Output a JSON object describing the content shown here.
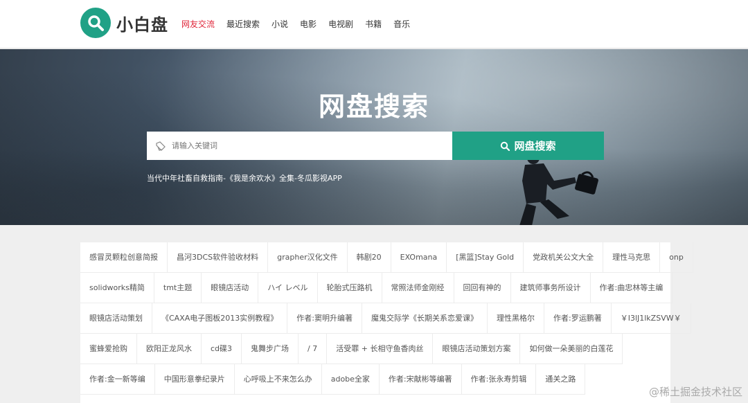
{
  "header": {
    "logo_text": "小白盘",
    "nav": [
      {
        "label": "网友交流",
        "active": true
      },
      {
        "label": "最近搜索",
        "active": false
      },
      {
        "label": "小说",
        "active": false
      },
      {
        "label": "电影",
        "active": false
      },
      {
        "label": "电视剧",
        "active": false
      },
      {
        "label": "书籍",
        "active": false
      },
      {
        "label": "音乐",
        "active": false
      }
    ]
  },
  "hero": {
    "title": "网盘搜索",
    "search_placeholder": "请输入关键词",
    "search_button": "网盘搜索",
    "promo_link": "当代中年社畜自救指南-《我是余欢水》全集-冬瓜影视APP"
  },
  "tags": [
    [
      "感冒灵颗粒创意简报",
      "昌河3DCS软件验收材料",
      "grapher汉化文件",
      "韩剧20",
      "EXOmana",
      "[黑篮]Stay Gold",
      "党政机关公文大全",
      "理性马克思",
      "onp"
    ],
    [
      "solidworks精简",
      "tmt主题",
      "眼镜店活动",
      "ハイ レベル",
      "轮胎式压路机",
      "常照法师金刚经",
      "回回有神的",
      "建筑师事务所设计",
      "作者:曲忠林等主编"
    ],
    [
      "眼镜店活动策划",
      "《CAXA电子图板2013实例教程》",
      "作者:窦明升编著",
      "魔鬼交际学《长期关系恋爱课》",
      "理性黑格尔",
      "作者:罗运鹏著",
      "￥I3lJ1lkZSVW￥"
    ],
    [
      "蜜蜂爱抢购",
      "欧阳正龙风水",
      "cd碟3",
      "鬼舞步广场",
      "/ 7",
      "活受罪 + 长相守鱼香肉丝",
      "眼镜店活动策划方案",
      "如何做一朵美丽的白莲花"
    ],
    [
      "作者:金一新等编",
      "中国形意拳纪录片",
      "心呼吸上不来怎么办",
      "adobe全家",
      "作者:宋献彬等编著",
      "作者:张永寿剪辑",
      "通关之路"
    ]
  ],
  "watermark": "@稀土掘金技术社区",
  "colors": {
    "accent": "#20a186",
    "nav_active": "#e0263a"
  }
}
